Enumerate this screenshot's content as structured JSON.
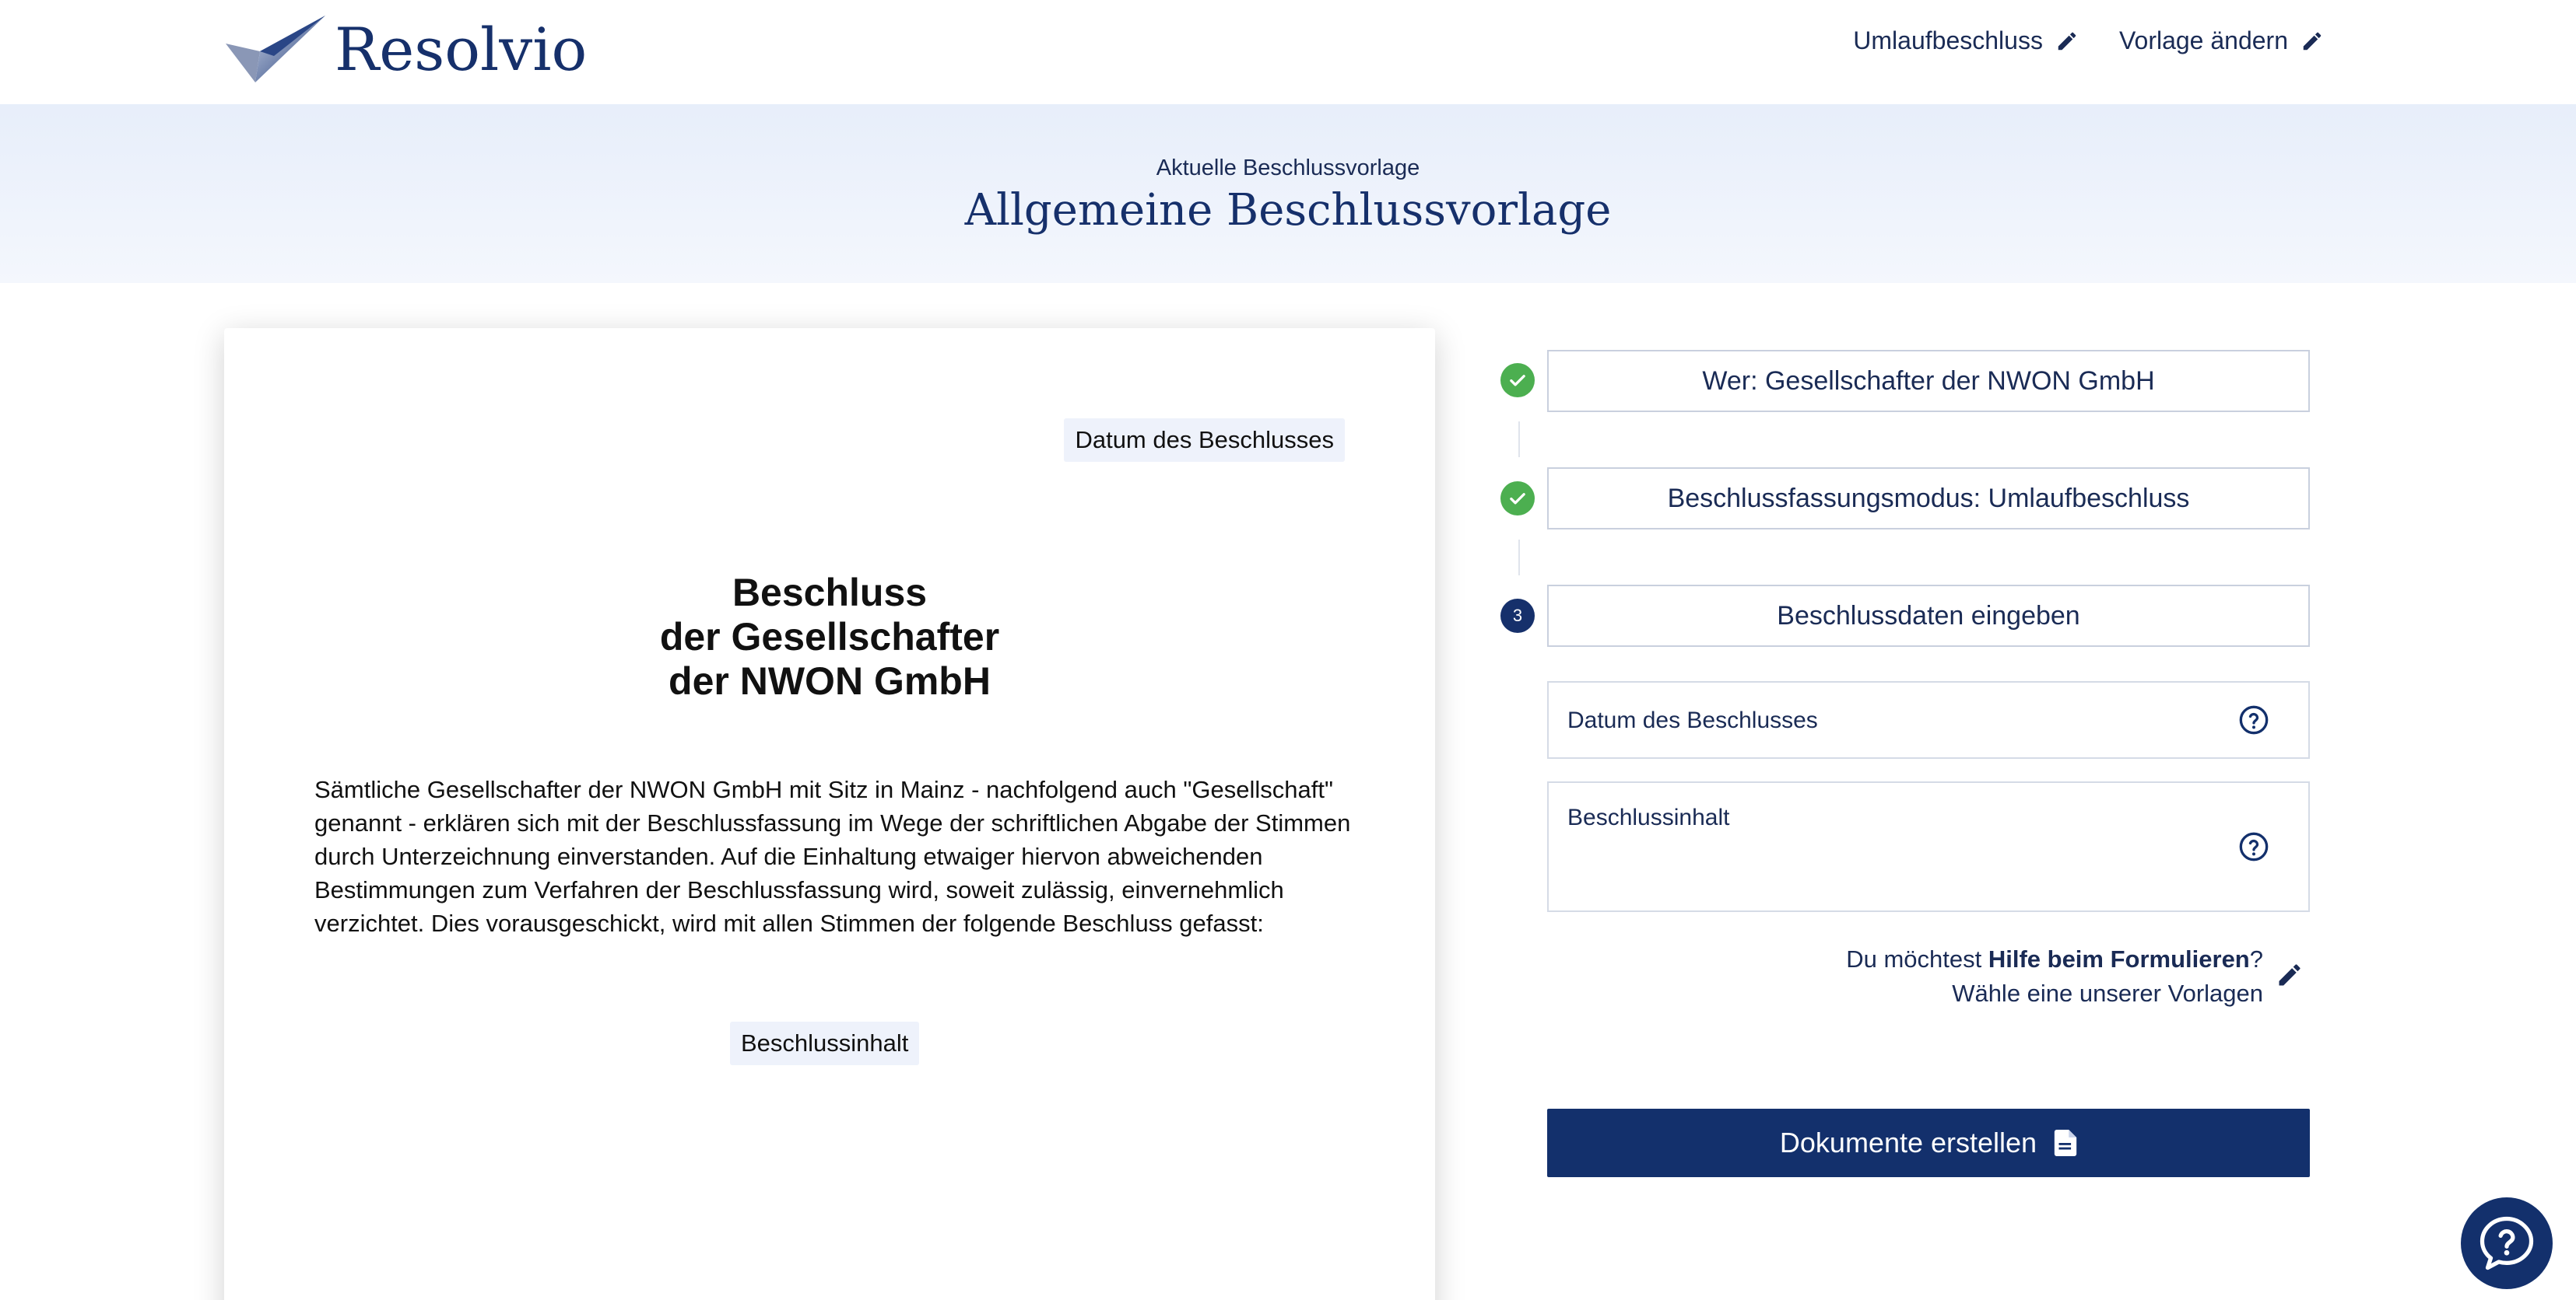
{
  "header": {
    "logo_text": "Resolvio",
    "nav": [
      {
        "label": "Umlaufbeschluss",
        "icon": "pencil-icon"
      },
      {
        "label": "Vorlage ändern",
        "icon": "pencil-icon"
      }
    ]
  },
  "banner": {
    "subtitle": "Aktuelle Beschlussvorlage",
    "title": "Allgemeine Beschlussvorlage"
  },
  "document": {
    "date_placeholder": "Datum des Beschlusses",
    "title_lines": [
      "Beschluss",
      "der Gesellschafter",
      "der NWON GmbH"
    ],
    "body": "Sämtliche Gesellschafter der NWON GmbH mit Sitz in Mainz - nachfolgend auch \"Gesellschaft\" genannt - erklären sich mit der Beschlussfassung im Wege der schriftlichen Abgabe der Stimmen durch Unterzeichnung einverstanden. Auf die Einhaltung etwaiger hiervon abweichenden Bestimmungen zum Verfahren der Beschlussfassung wird, soweit zulässig, einvernehmlich verzichtet. Dies vorausgeschickt, wird mit allen Stimmen der folgende Beschluss gefasst:",
    "content_placeholder": "Beschlussinhalt"
  },
  "steps": [
    {
      "label": "Wer: Gesellschafter der NWON GmbH",
      "status": "done"
    },
    {
      "label": "Beschlussfassungsmodus: Umlaufbeschluss",
      "status": "done"
    },
    {
      "label": "Beschlussdaten eingeben",
      "status": "current",
      "number": "3"
    }
  ],
  "form": {
    "date_label": "Datum des Beschlusses",
    "content_label": "Beschlussinhalt"
  },
  "hint": {
    "prefix": "Du möchtest ",
    "bold": "Hilfe beim Formulieren",
    "suffix": "?",
    "line2": "Wähle eine unserer Vorlagen"
  },
  "cta": {
    "label": "Dokumente erstellen",
    "icon": "document-icon"
  },
  "chat": {
    "icon": "help-chat-icon"
  },
  "colors": {
    "primary": "#13306c",
    "success": "#4caf50",
    "banner_bg": "#e7eefa",
    "chip_bg": "#eef2fb"
  }
}
